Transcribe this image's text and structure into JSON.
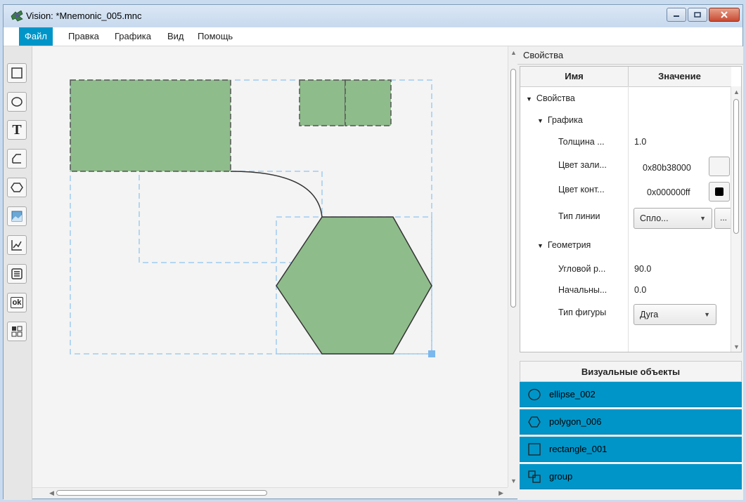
{
  "window": {
    "title": "Vision: *Mnemonic_005.mnc"
  },
  "menu": [
    {
      "label": "Файл",
      "active": true
    },
    {
      "label": "Правка"
    },
    {
      "label": "Графика"
    },
    {
      "label": "Вид"
    },
    {
      "label": "Помощь"
    }
  ],
  "toolbar": {
    "tools": [
      "rectangle-tool-icon",
      "ellipse-tool-icon",
      "text-tool-icon",
      "polyline-tool-icon",
      "polygon-tool-icon",
      "image-tool-icon",
      "trend-tool-icon",
      "table-tool-icon",
      "button-tool-icon",
      "widget-tool-icon"
    ],
    "text_glyph": "T",
    "ok_glyph": "ok"
  },
  "canvas": {
    "fill_color": "#8fbc8b",
    "stroke_color": "#333333",
    "selection_color": "#9ecbf0"
  },
  "properties": {
    "panel_title": "Свойства",
    "col_name": "Имя",
    "col_value": "Значение",
    "root": "Свойства",
    "group_graphics": "Графика",
    "thickness_label": "Толщина ...",
    "thickness_value": "1.0",
    "fill_label": "Цвет зали...",
    "fill_value": "0x80b38000",
    "stroke_label": "Цвет конт...",
    "stroke_value": "0x000000ff",
    "linetype_label": "Тип линии",
    "linetype_value": "Спло...",
    "linetype_more": "...",
    "group_geometry": "Геометрия",
    "angle_label": "Угловой р...",
    "angle_value": "90.0",
    "start_label": "Начальны...",
    "start_value": "0.0",
    "shapetype_label": "Тип фигуры",
    "shapetype_value": "Дуга"
  },
  "visual_objects": {
    "title": "Визуальные объекты",
    "items": [
      {
        "label": "ellipse_002",
        "icon": "ellipse-icon"
      },
      {
        "label": "polygon_006",
        "icon": "polygon-icon"
      },
      {
        "label": "rectangle_001",
        "icon": "rectangle-icon"
      },
      {
        "label": "group",
        "icon": "group-icon"
      }
    ],
    "highlight_color": "#0095c8"
  }
}
